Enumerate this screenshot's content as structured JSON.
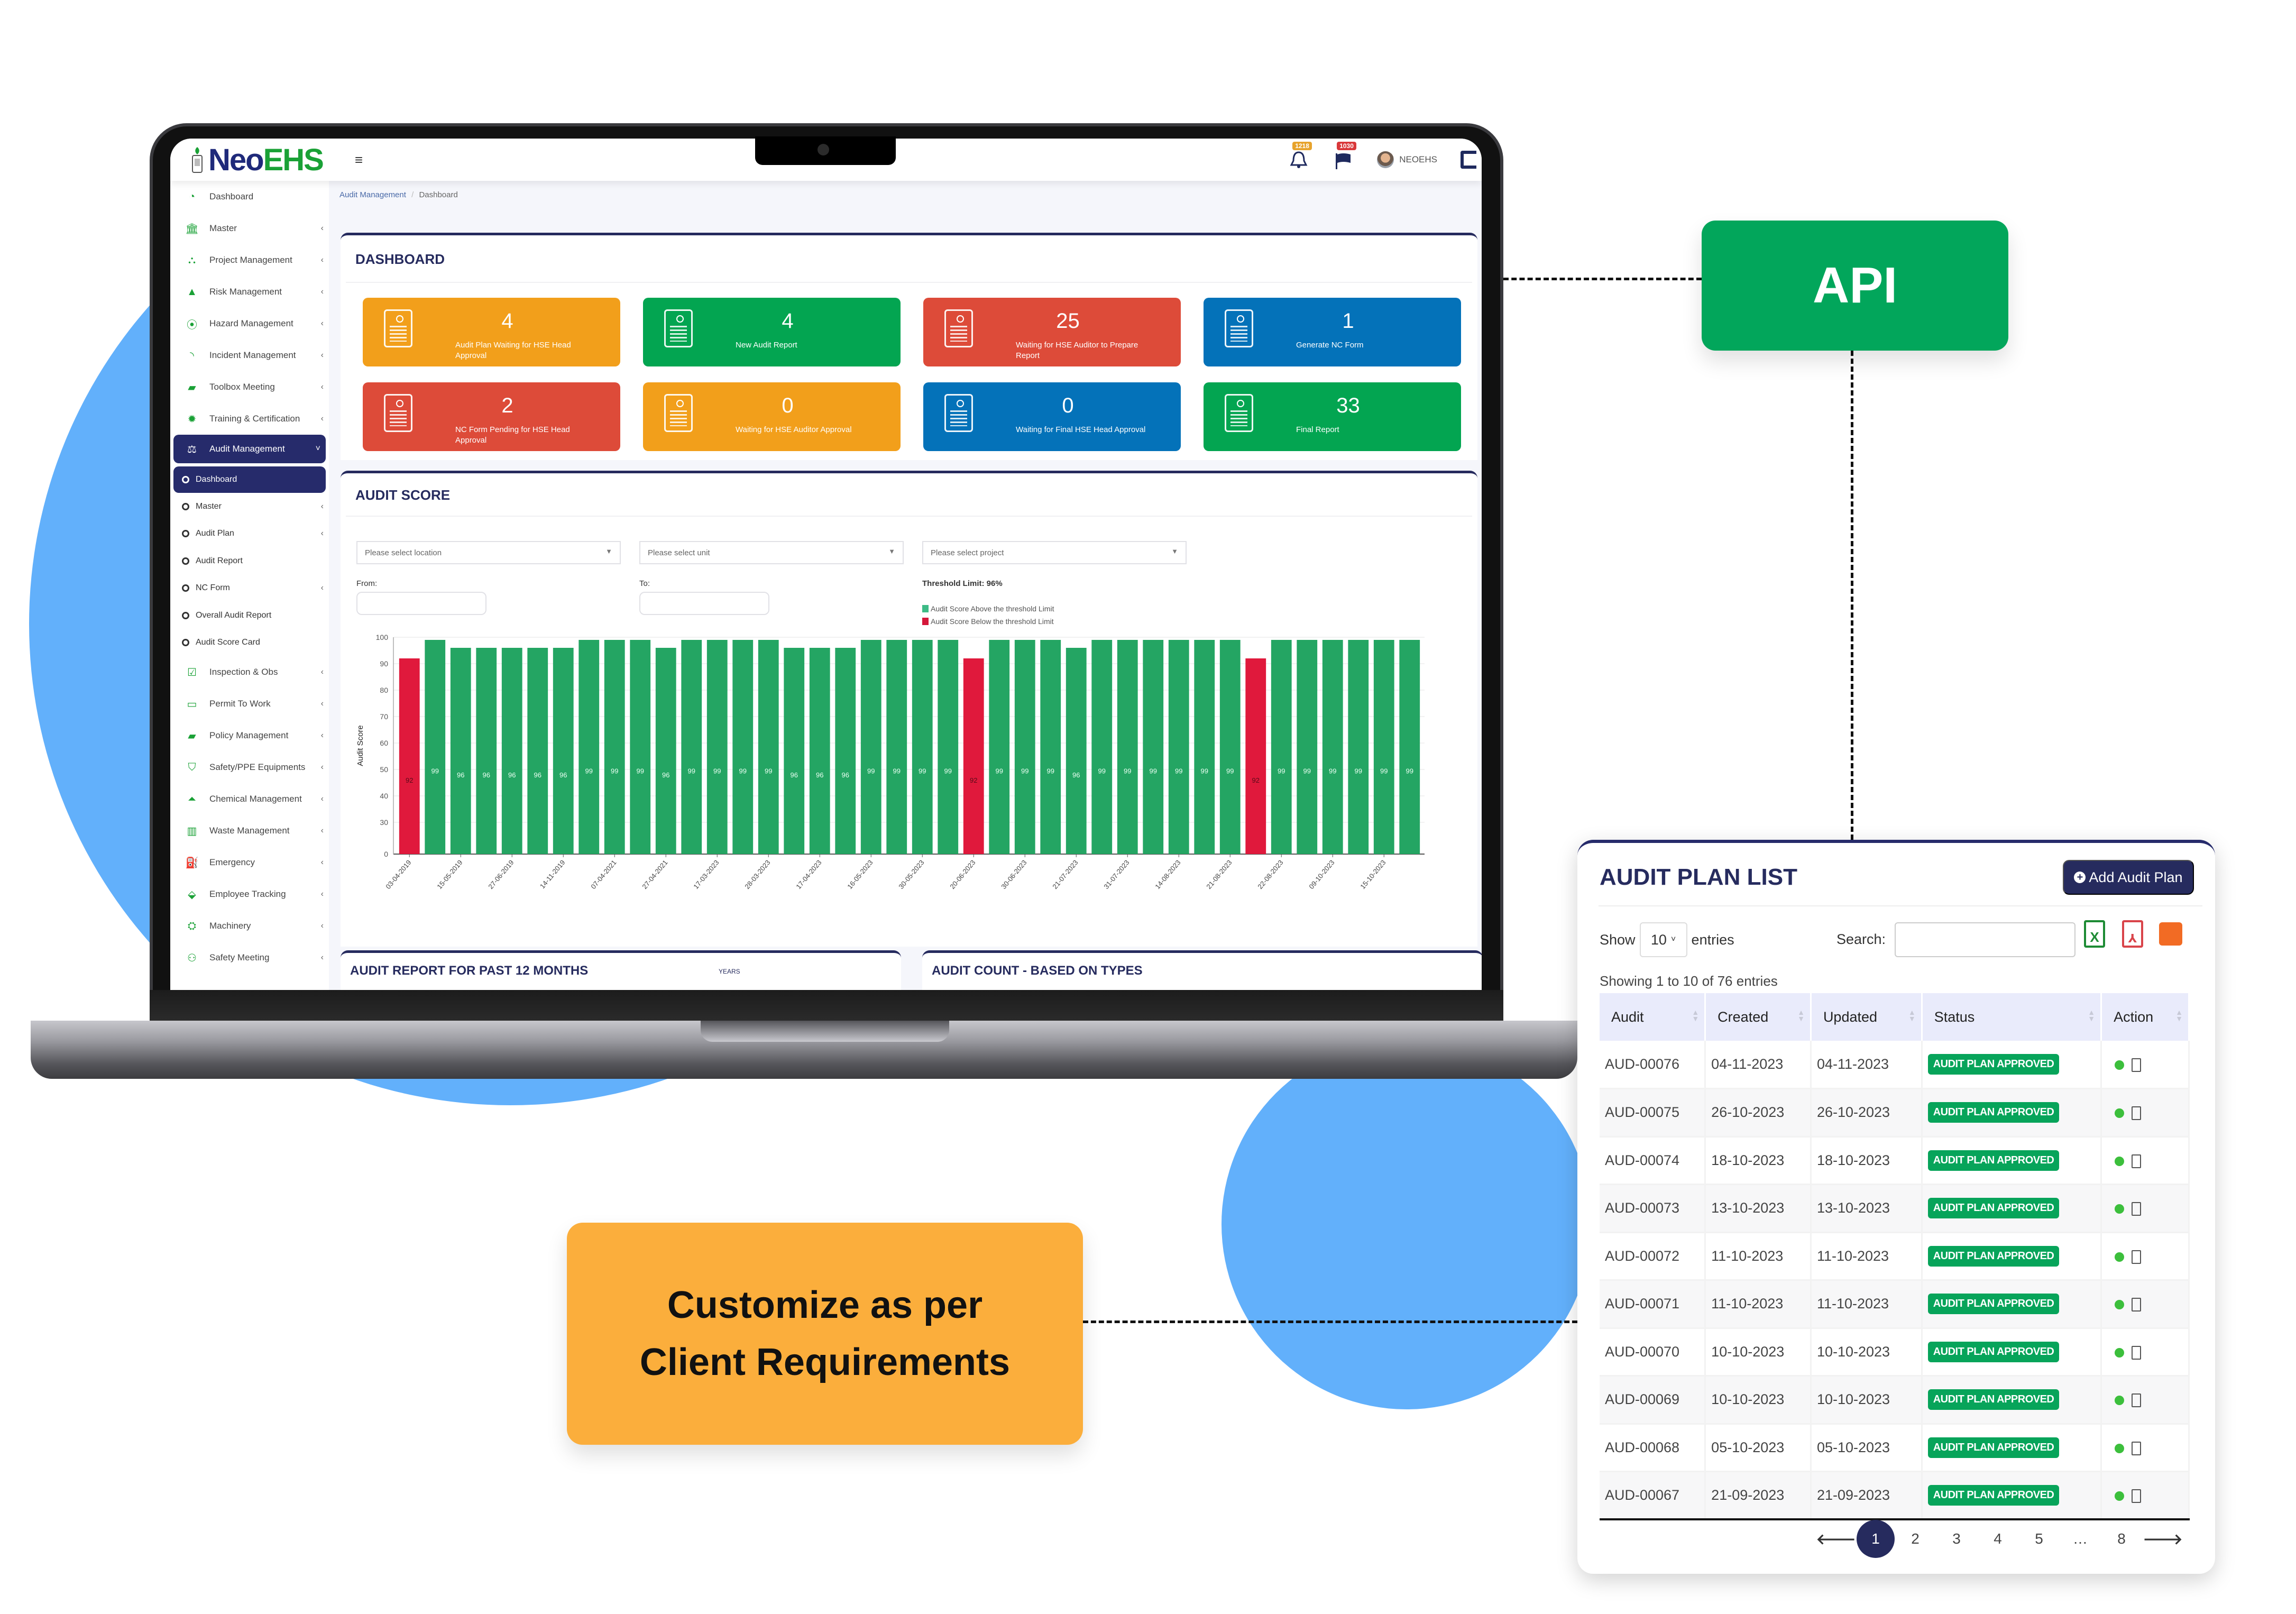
{
  "app": {
    "logo_neo": "Neo",
    "logo_ehs": "EHS",
    "hamburger_icon": "menu-icon",
    "notifications_count": "1218",
    "flags_count": "1030",
    "user_name": "NEOEHS"
  },
  "sidebar": {
    "items": [
      {
        "label": "Dashboard",
        "icon": "dashboard-gauge-icon",
        "glyph": "◔",
        "has_chevron": false
      },
      {
        "label": "Master",
        "icon": "bank-icon",
        "glyph": "🏛",
        "has_chevron": true
      },
      {
        "label": "Project Management",
        "icon": "sitemap-icon",
        "glyph": "⛬",
        "has_chevron": true
      },
      {
        "label": "Risk Management",
        "icon": "warning-icon",
        "glyph": "▲",
        "has_chevron": true
      },
      {
        "label": "Hazard Management",
        "icon": "podcast-icon",
        "glyph": "⦿",
        "has_chevron": true
      },
      {
        "label": "Incident Management",
        "icon": "rss-icon",
        "glyph": "◝",
        "has_chevron": true
      },
      {
        "label": "Toolbox Meeting",
        "icon": "briefcase-icon",
        "glyph": "▰",
        "has_chevron": true
      },
      {
        "label": "Training & Certification",
        "icon": "certificate-icon",
        "glyph": "✹",
        "has_chevron": true
      }
    ],
    "active_item": {
      "label": "Audit Management",
      "icon": "balance-scale-icon",
      "glyph": "⚖"
    },
    "sub_items": [
      {
        "label": "Dashboard",
        "active": true,
        "has_chevron": false
      },
      {
        "label": "Master",
        "active": false,
        "has_chevron": true
      },
      {
        "label": "Audit Plan",
        "active": false,
        "has_chevron": true
      },
      {
        "label": "Audit Report",
        "active": false,
        "has_chevron": false
      },
      {
        "label": "NC Form",
        "active": false,
        "has_chevron": true
      },
      {
        "label": "Overall Audit Report",
        "active": false,
        "has_chevron": false
      },
      {
        "label": "Audit Score Card",
        "active": false,
        "has_chevron": false
      }
    ],
    "items_after": [
      {
        "label": "Inspection & Obs",
        "icon": "check-square-icon",
        "glyph": "☑"
      },
      {
        "label": "Permit To Work",
        "icon": "id-card-icon",
        "glyph": "▭"
      },
      {
        "label": "Policy Management",
        "icon": "book-icon",
        "glyph": "▰"
      },
      {
        "label": "Safety/PPE Equipments",
        "icon": "shield-icon",
        "glyph": "⛉"
      },
      {
        "label": "Chemical Management",
        "icon": "flask-icon",
        "glyph": "⏶"
      },
      {
        "label": "Waste Management",
        "icon": "trash-icon",
        "glyph": "▥"
      },
      {
        "label": "Emergency",
        "icon": "fire-extinguisher-icon",
        "glyph": "⛽"
      },
      {
        "label": "Employee Tracking",
        "icon": "map-marker-icon",
        "glyph": "⬙"
      },
      {
        "label": "Machinery",
        "icon": "machinery-icon",
        "glyph": "⛭"
      },
      {
        "label": "Safety Meeting",
        "icon": "users-icon",
        "glyph": "⚇"
      }
    ],
    "chevron": "‹",
    "chevron_open": "˅"
  },
  "breadcrumb": {
    "parent": "Audit Management",
    "separator": "/",
    "current": "Dashboard"
  },
  "dashboard": {
    "title": "DASHBOARD",
    "tiles": [
      {
        "value": "4",
        "label": "Audit Plan Waiting for HSE Head Approval",
        "color": "#f29f1b"
      },
      {
        "value": "4",
        "label": "New Audit Report",
        "color": "#03a551"
      },
      {
        "value": "25",
        "label": "Waiting for HSE Auditor to Prepare Report",
        "color": "#dd4b39"
      },
      {
        "value": "1",
        "label": "Generate NC Form",
        "color": "#0472b9"
      },
      {
        "value": "2",
        "label": "NC Form Pending for HSE Head Approval",
        "color": "#dd4b39"
      },
      {
        "value": "0",
        "label": "Waiting for HSE Auditor Approval",
        "color": "#f29f1b"
      },
      {
        "value": "0",
        "label": "Waiting for Final HSE Head Approval",
        "color": "#0472b9"
      },
      {
        "value": "33",
        "label": "Final Report",
        "color": "#03a551"
      }
    ]
  },
  "audit_score": {
    "title": "AUDIT SCORE",
    "location_placeholder": "Please select location",
    "unit_placeholder": "Please select unit",
    "project_placeholder": "Please select project",
    "from_label": "From:",
    "to_label": "To:",
    "threshold_label": "Threshold Limit: 96%",
    "legend_above": "Audit Score Above the threshold Limit",
    "legend_below": "Audit Score Below the threshold Limit"
  },
  "chart_data": {
    "type": "bar",
    "title": "AUDIT SCORE",
    "xlabel": "",
    "ylabel": "Audit Score",
    "yticks": [
      0,
      30,
      40,
      50,
      60,
      70,
      80,
      90,
      100
    ],
    "ylim": [
      0,
      100
    ],
    "threshold": 96,
    "colors": {
      "above": "#24a563",
      "below": "#e0193c"
    },
    "values": [
      92,
      99,
      96,
      96,
      96,
      96,
      96,
      99,
      99,
      99,
      96,
      99,
      99,
      99,
      99,
      96,
      96,
      96,
      99,
      99,
      99,
      99,
      92,
      99,
      99,
      99,
      96,
      99,
      99,
      99,
      99,
      99,
      99,
      92,
      99,
      99,
      99,
      99,
      99,
      99
    ],
    "x_tick_labels": [
      "03-04-2019",
      "15-05-2019",
      "27-06-2019",
      "14-11-2019",
      "07-04-2021",
      "27-04-2021",
      "17-03-2023",
      "28-03-2023",
      "17-04-2023",
      "16-05-2023",
      "30-05-2023",
      "20-06-2023",
      "30-06-2023",
      "21-07-2023",
      "31-07-2023",
      "14-08-2023",
      "21-08-2023",
      "22-08-2023",
      "09-10-2023",
      "15-10-2023"
    ],
    "x_tick_every": 2,
    "grid": true,
    "legend": "top-right"
  },
  "bottom_cards": {
    "left_title": "AUDIT REPORT FOR PAST 12 MONTHS",
    "left_extra": "YEARS",
    "right_title": "AUDIT COUNT - BASED ON TYPES"
  },
  "callouts": {
    "api": "API",
    "customize_line1": "Customize as per",
    "customize_line2": "Client Requirements"
  },
  "audit_plan_list": {
    "title": "AUDIT PLAN LIST",
    "add_button": "Add Audit Plan",
    "show_label": "Show",
    "page_size": "10",
    "entries_label": "entries",
    "search_label": "Search:",
    "search_value": "",
    "showing_text": "Showing 1 to 10 of 76 entries",
    "columns": [
      "Audit",
      "Created",
      "Updated",
      "Status",
      "Action"
    ],
    "rows": [
      {
        "audit": "AUD-00076",
        "created": "04-11-2023",
        "updated": "04-11-2023",
        "status": "AUDIT PLAN APPROVED"
      },
      {
        "audit": "AUD-00075",
        "created": "26-10-2023",
        "updated": "26-10-2023",
        "status": "AUDIT PLAN APPROVED"
      },
      {
        "audit": "AUD-00074",
        "created": "18-10-2023",
        "updated": "18-10-2023",
        "status": "AUDIT PLAN APPROVED"
      },
      {
        "audit": "AUD-00073",
        "created": "13-10-2023",
        "updated": "13-10-2023",
        "status": "AUDIT PLAN APPROVED"
      },
      {
        "audit": "AUD-00072",
        "created": "11-10-2023",
        "updated": "11-10-2023",
        "status": "AUDIT PLAN APPROVED"
      },
      {
        "audit": "AUD-00071",
        "created": "11-10-2023",
        "updated": "11-10-2023",
        "status": "AUDIT PLAN APPROVED"
      },
      {
        "audit": "AUD-00070",
        "created": "10-10-2023",
        "updated": "10-10-2023",
        "status": "AUDIT PLAN APPROVED"
      },
      {
        "audit": "AUD-00069",
        "created": "10-10-2023",
        "updated": "10-10-2023",
        "status": "AUDIT PLAN APPROVED"
      },
      {
        "audit": "AUD-00068",
        "created": "05-10-2023",
        "updated": "05-10-2023",
        "status": "AUDIT PLAN APPROVED"
      },
      {
        "audit": "AUD-00067",
        "created": "21-09-2023",
        "updated": "21-09-2023",
        "status": "AUDIT PLAN APPROVED"
      }
    ],
    "pagination": {
      "prev": "🡐",
      "pages": [
        "1",
        "2",
        "3",
        "4",
        "5",
        "…",
        "8"
      ],
      "current": "1",
      "next": "🡒"
    }
  }
}
